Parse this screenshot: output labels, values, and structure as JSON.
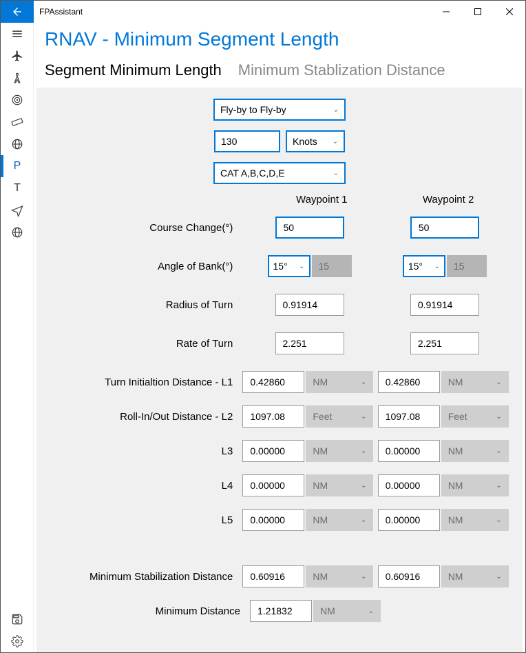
{
  "app": {
    "title": "FPAssistant"
  },
  "page": {
    "title": "RNAV - Minimum Segment Length"
  },
  "tabs": {
    "segment": "Segment Minimum Length",
    "msd": "Minimum Stablization Distance"
  },
  "controls": {
    "turnType": "Fly-by to Fly-by",
    "speedValue": "130",
    "speedUnit": "Knots",
    "category": "CAT A,B,C,D,E"
  },
  "headers": {
    "wp1": "Waypoint 1",
    "wp2": "Waypoint 2"
  },
  "rows": {
    "courseChange": {
      "label": "Course Change(°)",
      "wp1": "50",
      "wp2": "50"
    },
    "angleOfBank": {
      "label": "Angle of Bank(°)",
      "wp1sel": "15°",
      "wp1dis": "15",
      "wp2sel": "15°",
      "wp2dis": "15"
    },
    "radiusOfTurn": {
      "label": "Radius of Turn",
      "wp1": "0.91914",
      "wp2": "0.91914"
    },
    "rateOfTurn": {
      "label": "Rate of Turn",
      "wp1": "2.251",
      "wp2": "2.251"
    },
    "l1": {
      "label": "Turn Initialtion Distance - L1",
      "wp1": "0.42860",
      "wp2": "0.42860",
      "unit": "NM"
    },
    "l2": {
      "label": "Roll-In/Out Distance - L2",
      "wp1": "1097.08",
      "wp2": "1097.08",
      "unit": "Feet"
    },
    "l3": {
      "label": "L3",
      "wp1": "0.00000",
      "wp2": "0.00000",
      "unit": "NM"
    },
    "l4": {
      "label": "L4",
      "wp1": "0.00000",
      "wp2": "0.00000",
      "unit": "NM"
    },
    "l5": {
      "label": "L5",
      "wp1": "0.00000",
      "wp2": "0.00000",
      "unit": "NM"
    },
    "msd": {
      "label": "Minimum Stabilization Distance",
      "wp1": "0.60916",
      "wp2": "0.60916",
      "unit": "NM"
    },
    "minDist": {
      "label": "Minimum Distance",
      "val": "1.21832",
      "unit": "NM"
    }
  },
  "sidebar": {
    "p": "P",
    "t": "T"
  }
}
